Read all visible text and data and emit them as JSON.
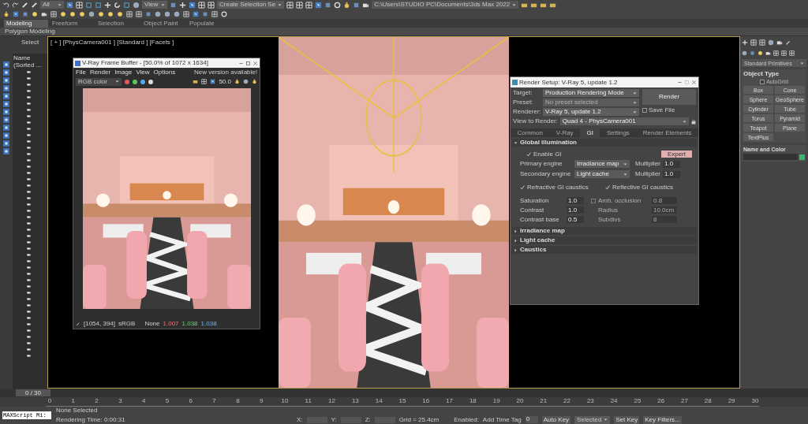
{
  "toolbar": {
    "selection_filter": "All",
    "reference_coordinate": "View",
    "named_selection": "Create Selection Se",
    "project_path": "C:\\Users\\STUDIO PC\\Documents\\3ds Max 2022"
  },
  "ribbon": {
    "tabs": [
      {
        "label": "Modeling",
        "selected": true
      },
      {
        "label": "Freeform",
        "selected": false
      },
      {
        "label": "Selection",
        "selected": false
      },
      {
        "label": "Object Paint",
        "selected": false
      },
      {
        "label": "Populate",
        "selected": false
      }
    ],
    "panel": "Polygon Modeling"
  },
  "scene_explorer": {
    "title": "Select",
    "column": "Name (Sorted ..."
  },
  "viewport": {
    "label": "[ + ] [PhysCamera001 ] [Standard ] [Facets ]"
  },
  "frame_buffer": {
    "title": "V-Ray Frame Buffer - [50.0% of 1072 x 1634]",
    "menu": [
      "File",
      "Render",
      "Image",
      "View",
      "Options"
    ],
    "notice": "New version available!",
    "channel": "RGB color",
    "zoom": "50.0",
    "coords": "[1054, 394]",
    "space": "sRGB",
    "lut": "None",
    "rgb": [
      "1.007",
      "1.038",
      "1.038"
    ]
  },
  "render_setup": {
    "title": "Render Setup: V-Ray 5, update 1.2",
    "fields": [
      {
        "label": "Target:",
        "value": "Production Rendering Mode",
        "disabled": false
      },
      {
        "label": "Preset:",
        "value": "No preset selected",
        "disabled": true
      },
      {
        "label": "Renderer:",
        "value": "V-Ray 5, update 1.2",
        "disabled": false
      }
    ],
    "render_button": "Render",
    "save_file": {
      "label": "Save File",
      "checked": false
    },
    "view": {
      "label": "View to Render:",
      "value": "Quad 4 - PhysCamera001"
    },
    "tabs": [
      {
        "label": "Common",
        "selected": false
      },
      {
        "label": "V-Ray",
        "selected": false
      },
      {
        "label": "GI",
        "selected": true
      },
      {
        "label": "Settings",
        "selected": false
      },
      {
        "label": "Render Elements",
        "selected": false
      }
    ],
    "rollouts": [
      {
        "title": "Global illumination",
        "expanded": true
      },
      {
        "title": "Irradiance map",
        "expanded": false
      },
      {
        "title": "Light cache",
        "expanded": false
      },
      {
        "title": "Caustics",
        "expanded": false
      }
    ],
    "gi": {
      "enable": {
        "label": "Enable GI",
        "checked": true
      },
      "mode_button": "Expert",
      "engines": [
        {
          "label": "Primary engine",
          "value": "Irradiance map",
          "multiplier_label": "Multiplier",
          "multiplier": "1.0"
        },
        {
          "label": "Secondary engine",
          "value": "Light cache",
          "multiplier_label": "Multiplier",
          "multiplier": "1.0"
        }
      ],
      "caustics": [
        {
          "label": "Refractive GI caustics",
          "checked": true
        },
        {
          "label": "Reflective GI caustics",
          "checked": true
        }
      ],
      "left_params": [
        {
          "label": "Saturation",
          "value": "1.0"
        },
        {
          "label": "Contrast",
          "value": "1.0"
        },
        {
          "label": "Contrast base",
          "value": "0.5"
        }
      ],
      "ao": {
        "label": "Amb. occlusion",
        "checked": false
      },
      "right_params": [
        {
          "value": "0.8"
        },
        {
          "label": "Radius",
          "value": "10.0cm"
        },
        {
          "label": "Subdivs",
          "value": "8"
        }
      ]
    }
  },
  "command_panel": {
    "category": "Standard Primitives",
    "object_type": "Object Type",
    "autogrid": {
      "label": "AutoGrid",
      "checked": false
    },
    "buttons": [
      "Box",
      "Cone",
      "Sphere",
      "GeoSphere",
      "Cylinder",
      "Tube",
      "Torus",
      "Pyramid",
      "Teapot",
      "Plane",
      "TextPlus"
    ],
    "name_and_color": "Name and Color",
    "color": "#3cb371"
  },
  "time_slider": "0 / 30",
  "ticks": [
    "0",
    "1",
    "2",
    "3",
    "4",
    "5",
    "6",
    "7",
    "8",
    "9",
    "10",
    "11",
    "12",
    "13",
    "14",
    "15",
    "16",
    "17",
    "18",
    "19",
    "20",
    "21",
    "22",
    "23",
    "24",
    "25",
    "26",
    "27",
    "28",
    "29",
    "30"
  ],
  "status": {
    "listener": "MAXScript Mi:",
    "selection": "None Selected",
    "prompt": "Rendering Time: 0:00:31",
    "x": "X:",
    "y": "Y:",
    "z": "Z:",
    "grid": "Grid = 25.4cm",
    "enabled": "Enabled:",
    "time_tag": "Add Time Tag",
    "auto_key": "Auto Key",
    "key_mode": "Selected",
    "set_key": "Set Key",
    "key_filters": "Key Filters...",
    "frame": "0"
  }
}
